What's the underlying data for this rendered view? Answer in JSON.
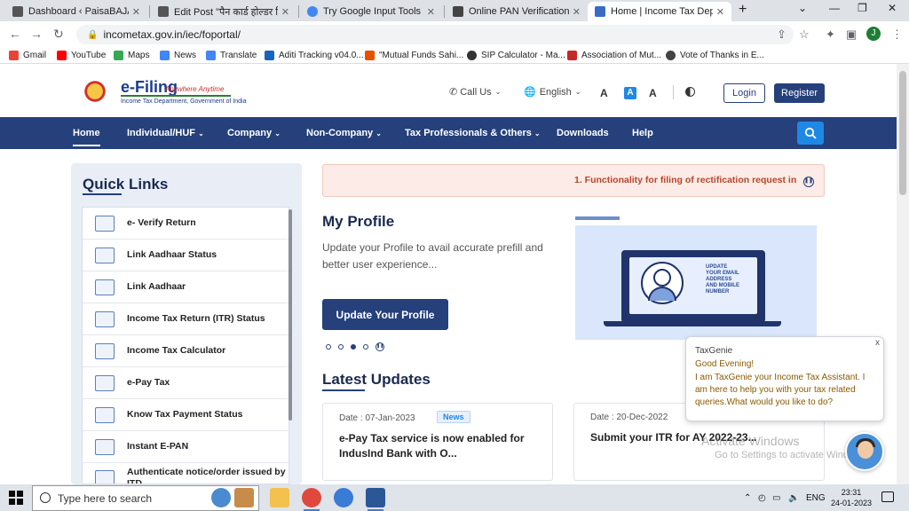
{
  "browser": {
    "tabs": [
      {
        "title": "Dashboard ‹ PaisaBAJAR.in —",
        "color": "#555555"
      },
      {
        "title": "Edit Post \"पैन कार्ड होल्डर निर्धि",
        "color": "#555555"
      },
      {
        "title": "Try Google Input Tools onlin",
        "color": "#4285f4"
      },
      {
        "title": "Online PAN Verification",
        "color": "#444444"
      },
      {
        "title": "Home | Income Tax Departm",
        "color": "#3b6bc4"
      }
    ],
    "new_tab": "+",
    "url": "incometax.gov.in/iec/foportal/",
    "profile_initial": "J",
    "bookmarks": [
      {
        "label": "Gmail",
        "color": "#ea4335"
      },
      {
        "label": "YouTube",
        "color": "#ff0000"
      },
      {
        "label": "Maps",
        "color": "#34a853"
      },
      {
        "label": "News",
        "color": "#4285f4"
      },
      {
        "label": "Translate",
        "color": "#4285f4"
      },
      {
        "label": "Aditi Tracking v04.0...",
        "color": "#1565c0"
      },
      {
        "label": "\"Mutual Funds Sahi...",
        "color": "#e65100"
      },
      {
        "label": "SIP Calculator - Ma...",
        "color": "#333333"
      },
      {
        "label": "Association of Mut...",
        "color": "#c62828"
      },
      {
        "label": "Vote of Thanks in E...",
        "color": "#444444"
      }
    ]
  },
  "site": {
    "logo_title": "e-Filing",
    "logo_tagline": "Anywhere Anytime",
    "logo_sub": "Income Tax Department, Government of India",
    "header": {
      "call_us": "Call Us",
      "language": "English",
      "font_small": "A",
      "font_normal": "A",
      "font_large": "A",
      "login": "Login",
      "register": "Register"
    },
    "nav": [
      "Home",
      "Individual/HUF",
      "Company",
      "Non-Company",
      "Tax Professionals & Others",
      "Downloads",
      "Help"
    ],
    "quick_links_title": "Quick Links",
    "quick_links": [
      "e- Verify Return",
      "Link Aadhaar Status",
      "Link Aadhaar",
      "Income Tax Return (ITR) Status",
      "Income Tax Calculator",
      "e-Pay Tax",
      "Know Tax Payment Status",
      "Instant E-PAN",
      "Authenticate notice/order issued by ITD"
    ],
    "ticker": "1. Functionality for filing of rectification request in",
    "profile": {
      "title": "My Profile",
      "desc": "Update your Profile to avail accurate prefill and better user experience...",
      "button": "Update Your Profile",
      "banner_text": "UPDATE YOUR EMAIL ADDRESS AND MOBILE NUMBER"
    },
    "latest_title": "Latest Updates",
    "updates": [
      {
        "date": "Date : 07-Jan-2023",
        "badge": "News",
        "text": "e-Pay Tax service is now enabled for IndusInd Bank with O..."
      },
      {
        "date": "Date : 20-Dec-2022",
        "badge": "",
        "text": "Submit your ITR for AY 2022-23..."
      }
    ],
    "chat": {
      "name": "TaxGenie",
      "greeting": "Good Evening!",
      "body": "I am TaxGenie your Income Tax Assistant. I am here to help you with your tax related queries.What would you like to do?",
      "close": "x"
    }
  },
  "watermark": {
    "line1": "Activate Windows",
    "line2": "Go to Settings to activate Windows."
  },
  "taskbar": {
    "search_placeholder": "Type here to search",
    "lang": "ENG",
    "time": "23:31",
    "date": "24-01-2023"
  }
}
